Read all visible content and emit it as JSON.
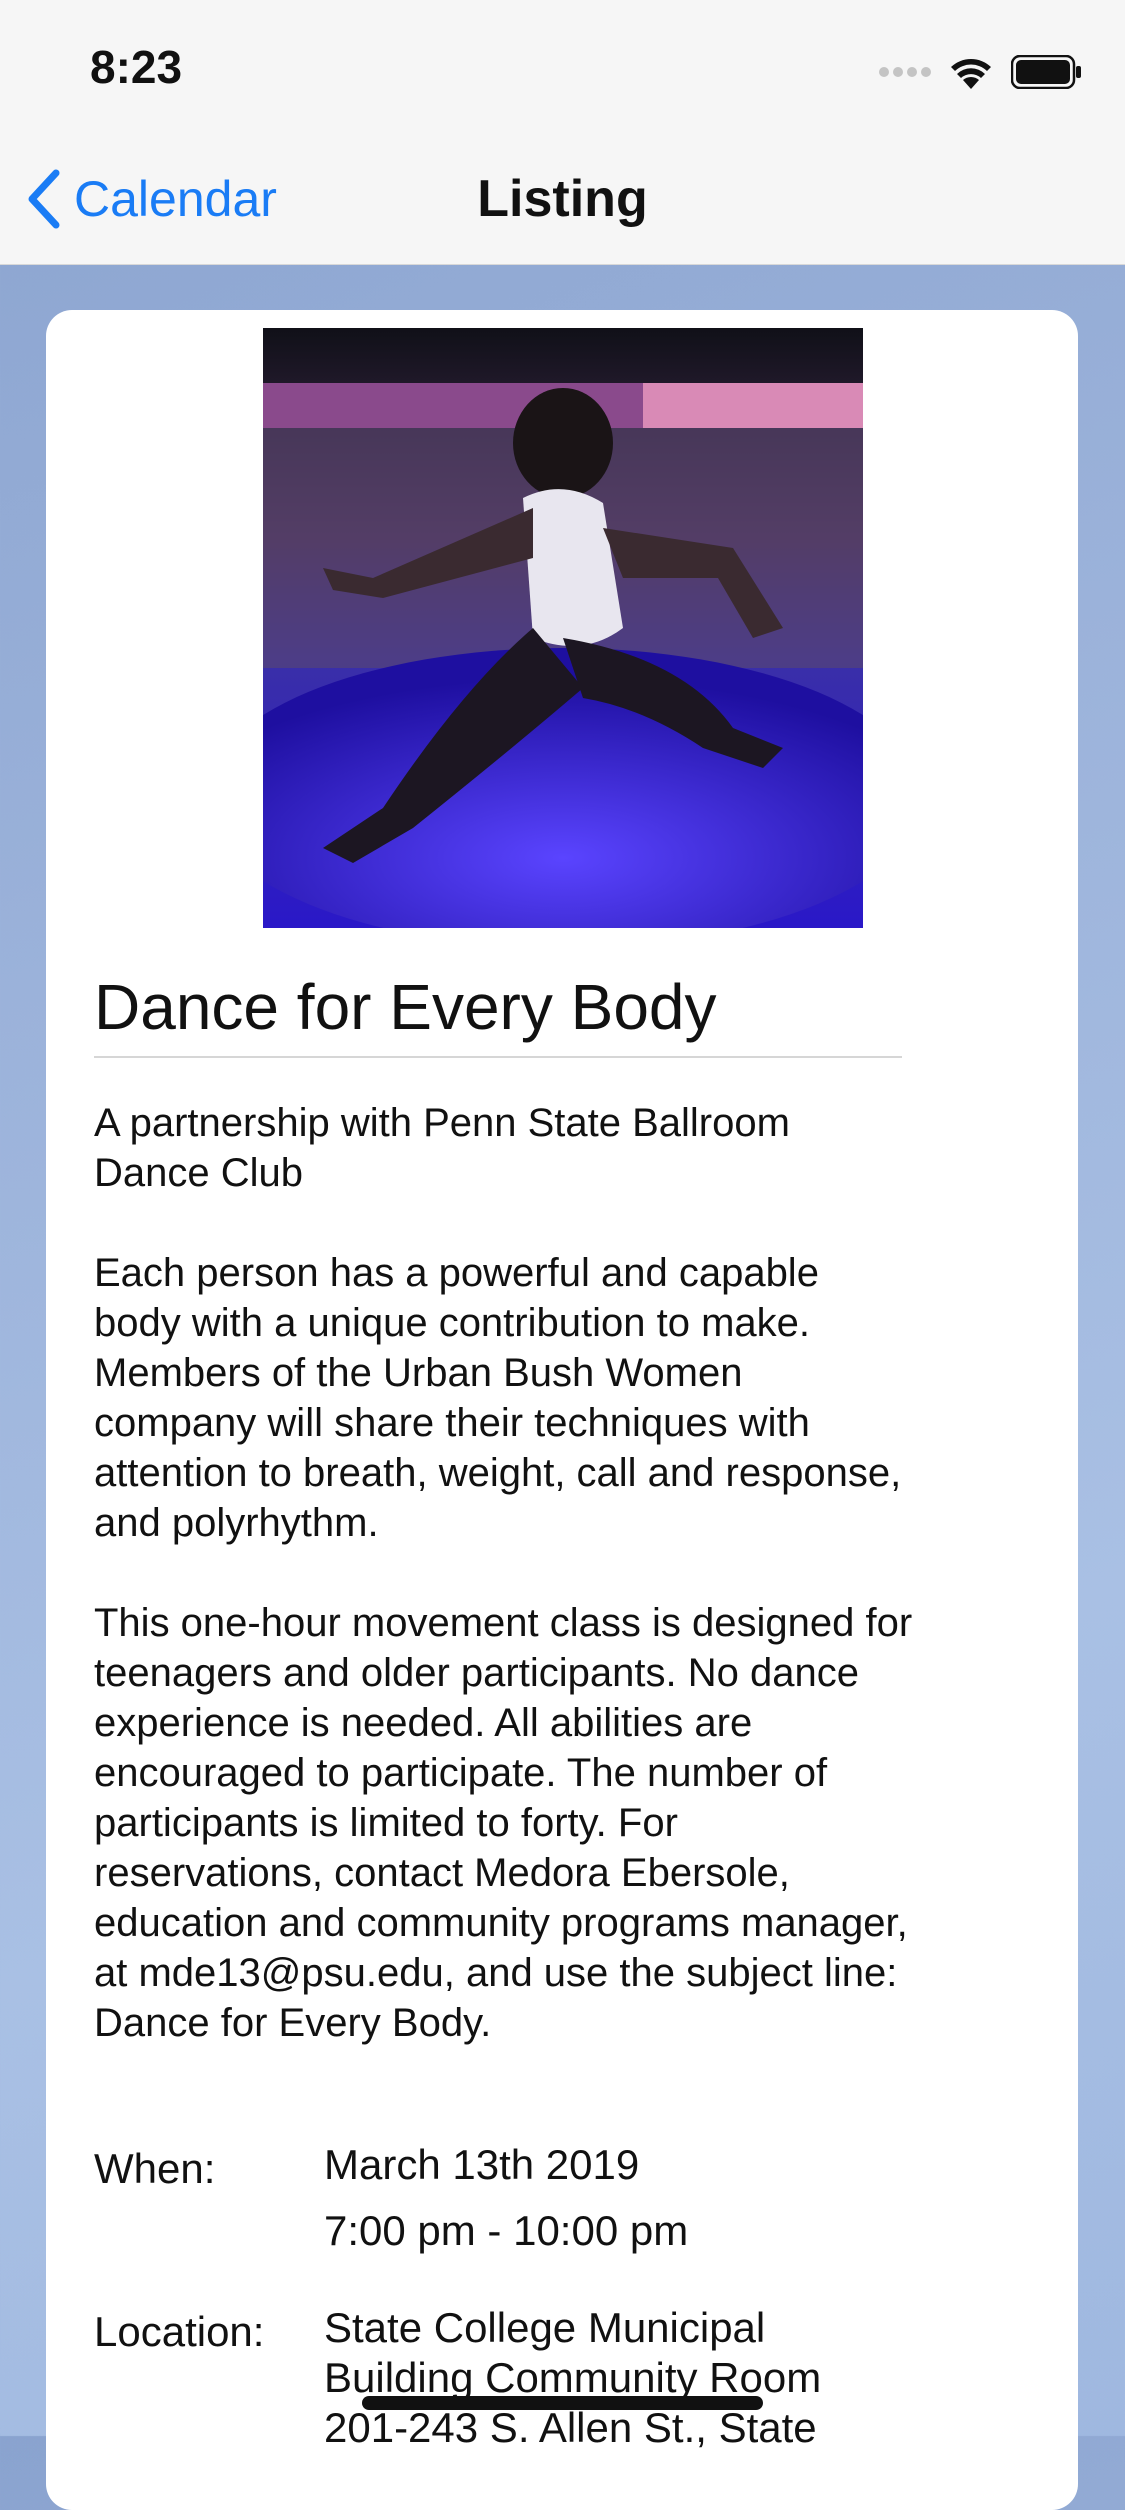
{
  "status_bar": {
    "time": "8:23"
  },
  "nav": {
    "back_label": "Calendar",
    "title": "Listing"
  },
  "event": {
    "title": "Dance for Every Body",
    "subtitle": "A partnership with Penn State Ballroom Dance Club",
    "description_1": "Each person has a powerful and capable body with a unique contribution to make. Members of the Urban Bush Women company will share their techniques with attention to breath, weight, call and response, and polyrhythm.",
    "description_2": "This one-hour movement class is designed for teenagers and older participants. No dance experience is needed. All abilities are encouraged to participate. The number of participants is limited to forty. For reservations, contact Medora Ebersole, education and community programs manager, at mde13@psu.edu, and use the subject line: Dance for Every Body.",
    "when_label": "When:",
    "date": "March 13th 2019",
    "time": "7:00 pm - 10:00 pm",
    "location_label": "Location:",
    "location_line_1": "State College Municipal",
    "location_line_2": "Building Community Room",
    "location_line_3": "201-243 S. Allen St., State"
  },
  "colors": {
    "accent": "#1a7cf5",
    "background": "#9bb2da"
  }
}
